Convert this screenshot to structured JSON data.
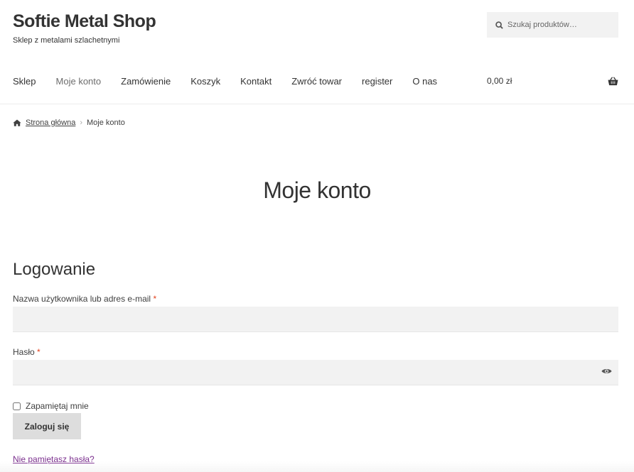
{
  "site": {
    "title": "Softie Metal Shop",
    "description": "Sklep z metalami szlachetnymi"
  },
  "search": {
    "placeholder": "Szukaj produktów…",
    "icon": "search-icon"
  },
  "nav": {
    "items": [
      {
        "label": "Sklep"
      },
      {
        "label": "Moje konto",
        "active": true
      },
      {
        "label": "Zamówienie"
      },
      {
        "label": "Koszyk"
      },
      {
        "label": "Kontakt"
      },
      {
        "label": "Zwróć towar"
      },
      {
        "label": "register"
      },
      {
        "label": "O nas"
      }
    ]
  },
  "cart": {
    "total": "0,00 zł",
    "icon": "basket-icon"
  },
  "breadcrumb": {
    "home_icon": "home-icon",
    "home_label": "Strona główna",
    "separator": "›",
    "current": "Moje konto"
  },
  "page": {
    "title": "Moje konto"
  },
  "login": {
    "heading": "Logowanie",
    "username_label": "Nazwa użytkownika lub adres e-mail",
    "password_label": "Hasło",
    "required_mark": "*",
    "remember_label": "Zapamiętaj mnie",
    "submit_label": "Zaloguj się",
    "lost_password_label": "Nie pamiętasz hasła?",
    "show_password_icon": "eye-icon"
  },
  "colors": {
    "required": "#e2401c",
    "link_visited": "#7b2f8e",
    "field_bg": "#f2f2f2",
    "button_bg": "#dddddd"
  }
}
